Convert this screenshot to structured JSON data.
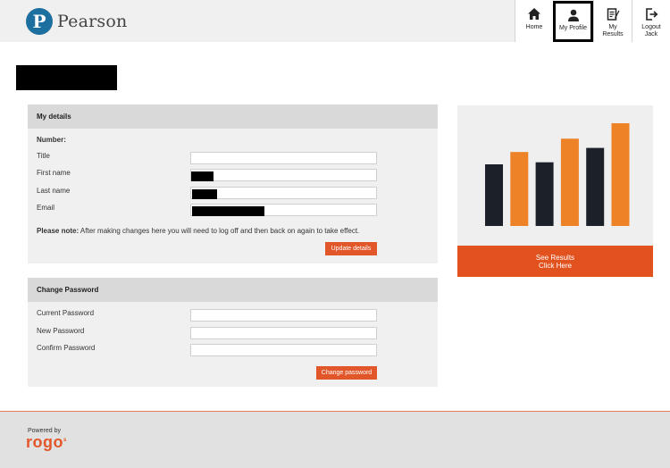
{
  "header": {
    "logo_letter": "P",
    "logo_text": "Pearson",
    "nav": [
      {
        "label": "Home",
        "icon": "home-icon"
      },
      {
        "label": "My Profile",
        "icon": "user-icon",
        "active": true
      },
      {
        "label": "My\nResults",
        "icon": "results-icon"
      },
      {
        "label": "Logout\nJack",
        "icon": "logout-icon"
      }
    ]
  },
  "my_details": {
    "title": "My details",
    "number_label": "Number:",
    "fields": [
      {
        "label": "Title",
        "value": ""
      },
      {
        "label": "First name",
        "value": ""
      },
      {
        "label": "Last name",
        "value": ""
      },
      {
        "label": "Email",
        "value": ""
      }
    ],
    "note_bold": "Please note:",
    "note_text": " After making changes here you will need to log off and then back on again to take effect.",
    "button": "Update details"
  },
  "change_password": {
    "title": "Change Password",
    "fields": [
      {
        "label": "Current Password",
        "value": ""
      },
      {
        "label": "New Password",
        "value": ""
      },
      {
        "label": "Confirm Password",
        "value": ""
      }
    ],
    "button": "Change password"
  },
  "results_card": {
    "button_line1": "See Results",
    "button_line2": "Click Here",
    "bars": [
      {
        "value": 0.6,
        "color": "#1c2129"
      },
      {
        "value": 0.72,
        "color": "#ee8226"
      },
      {
        "value": 0.62,
        "color": "#1c2129"
      },
      {
        "value": 0.85,
        "color": "#ee8226"
      },
      {
        "value": 0.76,
        "color": "#1c2129"
      },
      {
        "value": 1.0,
        "color": "#ee8226"
      }
    ]
  },
  "footer": {
    "powered_by": "Powered by",
    "brand": "rogo",
    "brand_sup": "s"
  }
}
